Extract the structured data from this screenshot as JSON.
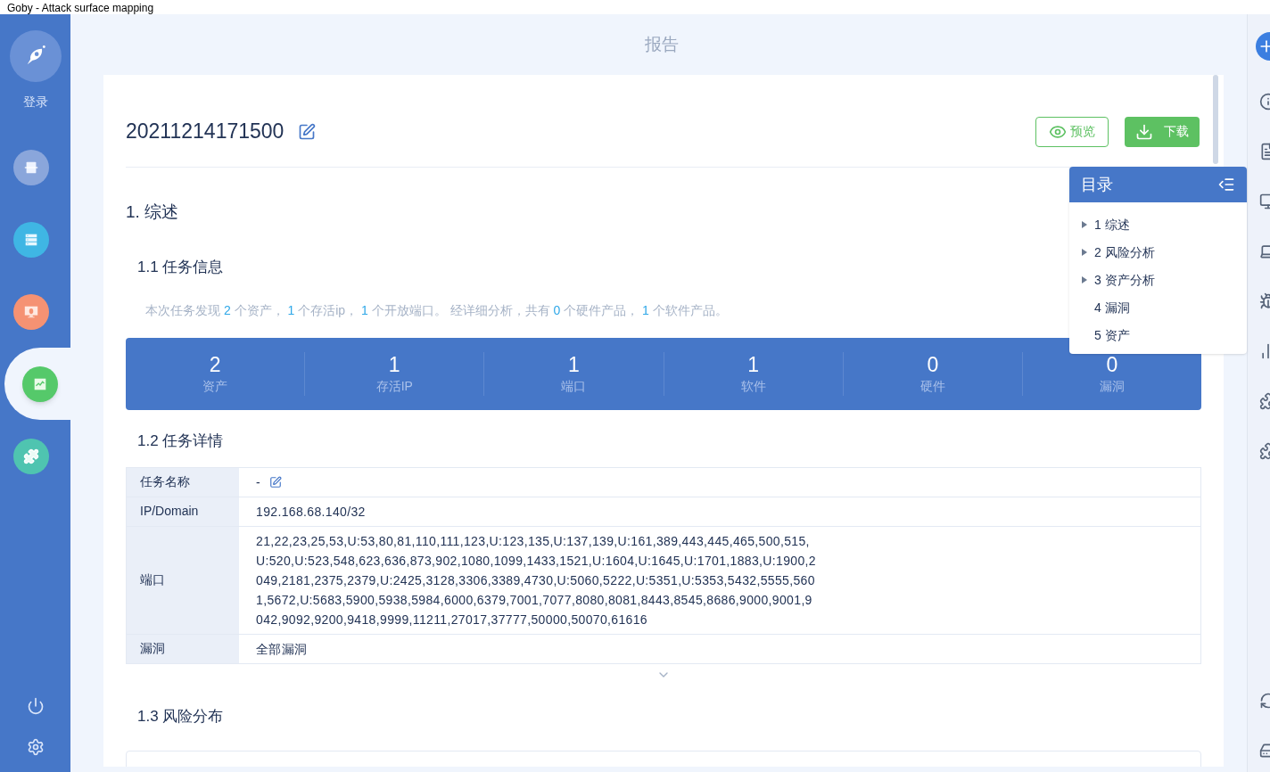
{
  "window": {
    "title": "Goby - Attack surface mapping"
  },
  "sidebar": {
    "login": "登录",
    "items": [
      {
        "kind": "scan",
        "color": "#8aa6db",
        "selected": false
      },
      {
        "kind": "assets",
        "color": "#3fb6e4",
        "selected": false
      },
      {
        "kind": "bug",
        "color": "#f59273",
        "selected": false
      },
      {
        "kind": "report",
        "color": "#55c96a",
        "selected": true
      },
      {
        "kind": "plugin",
        "color": "#4fc4b0",
        "selected": false
      }
    ]
  },
  "page_title": "报告",
  "report": {
    "name": "20211214171500",
    "buttons": [
      {
        "kind": "preview",
        "label": "预览"
      },
      {
        "kind": "download",
        "label": "下载"
      }
    ],
    "section_1": "1. 综述",
    "section_1_1": "1.1 任务信息",
    "summary": [
      {
        "text": "本次任务发现 ",
        "highlight": false
      },
      {
        "text": "2",
        "highlight": true
      },
      {
        "text": " 个资产， ",
        "highlight": false
      },
      {
        "text": "1",
        "highlight": true
      },
      {
        "text": " 个存活ip， ",
        "highlight": false
      },
      {
        "text": "1",
        "highlight": true
      },
      {
        "text": " 个开放端口。 经详细分析，共有 ",
        "highlight": false
      },
      {
        "text": "0",
        "highlight": true
      },
      {
        "text": " 个硬件产品， ",
        "highlight": false
      },
      {
        "text": "1",
        "highlight": true
      },
      {
        "text": " 个软件产品。",
        "highlight": false
      }
    ],
    "stats": [
      {
        "value": "2",
        "label": "资产"
      },
      {
        "value": "1",
        "label": "存活IP"
      },
      {
        "value": "1",
        "label": "端口"
      },
      {
        "value": "1",
        "label": "软件"
      },
      {
        "value": "0",
        "label": "硬件"
      },
      {
        "value": "0",
        "label": "漏洞"
      }
    ],
    "section_1_2": "1.2 任务详情",
    "details": [
      {
        "label": "任务名称",
        "value": "-",
        "editable": true
      },
      {
        "label": "IP/Domain",
        "value": "192.168.68.140/32",
        "editable": false
      },
      {
        "label": "端口",
        "value": "21,22,23,25,53,U:53,80,81,110,111,123,U:123,135,U:137,139,U:161,389,443,445,465,500,515,U:520,U:523,548,623,636,873,902,1080,1099,1433,1521,U:1604,U:1645,U:1701,1883,U:1900,2049,2181,2375,2379,U:2425,3128,3306,3389,4730,U:5060,5222,U:5351,U:5353,5432,5555,5601,5672,U:5683,5900,5938,5984,6000,6379,7001,7077,8080,8081,8443,8545,8686,9000,9001,9042,9092,9200,9418,9999,11211,27017,37777,50000,50070,61616",
        "editable": false
      },
      {
        "label": "漏洞",
        "value": "全部漏洞",
        "editable": false
      }
    ],
    "section_1_3": "1.3 风险分布"
  },
  "toc": {
    "title": "目录",
    "items": [
      {
        "label": "1 综述",
        "expandable": true
      },
      {
        "label": "2 风险分析",
        "expandable": true
      },
      {
        "label": "3 资产分析",
        "expandable": true
      },
      {
        "label": "4 漏洞",
        "expandable": false
      },
      {
        "label": "5 资产",
        "expandable": false
      }
    ]
  }
}
